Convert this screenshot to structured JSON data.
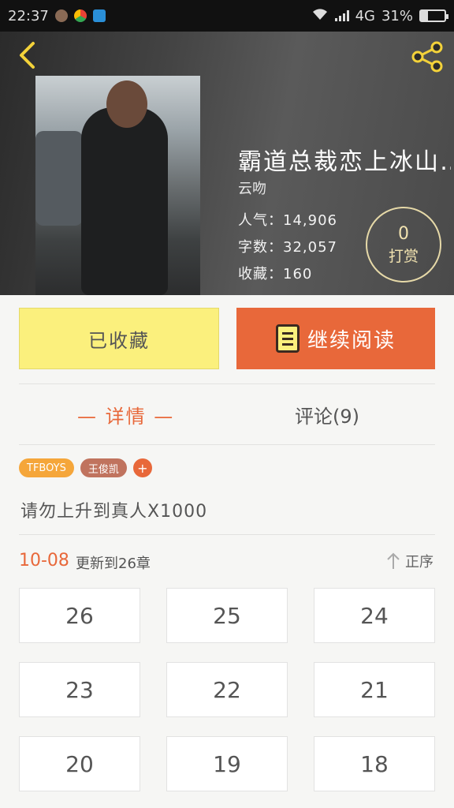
{
  "status_bar": {
    "time": "22:37",
    "network": "4G",
    "battery": "31%",
    "battery_level": 0.31
  },
  "header": {
    "title": "霸道总裁恋上冰山…",
    "author": "云吻",
    "stats": {
      "popularity": "人气：14,906",
      "word_count": "字数：32,057",
      "favorites": "收藏：160"
    },
    "reward": {
      "count": "0",
      "label": "打赏"
    }
  },
  "actions": {
    "collected_label": "已收藏",
    "continue_label": "继续阅读"
  },
  "tabs": {
    "details": "— 详情 —",
    "comments": "评论(9)"
  },
  "tags": [
    "TFBOYS",
    "王俊凯"
  ],
  "tag_add": "+",
  "description": "请勿上升到真人X1000",
  "update": {
    "date": "10-08",
    "text": "更新到26章",
    "sort_label": "正序"
  },
  "chapters": [
    "26",
    "25",
    "24",
    "23",
    "22",
    "21",
    "20",
    "19",
    "18"
  ],
  "colors": {
    "accent": "#e8683a",
    "collected_bg": "#fbf07d",
    "tag_orange": "#f5a63a",
    "tag_brown": "#c0735e"
  },
  "icons": {
    "back": "back-chevron-icon",
    "share": "share-icon",
    "book": "book-icon",
    "sort": "arrow-up-icon"
  }
}
